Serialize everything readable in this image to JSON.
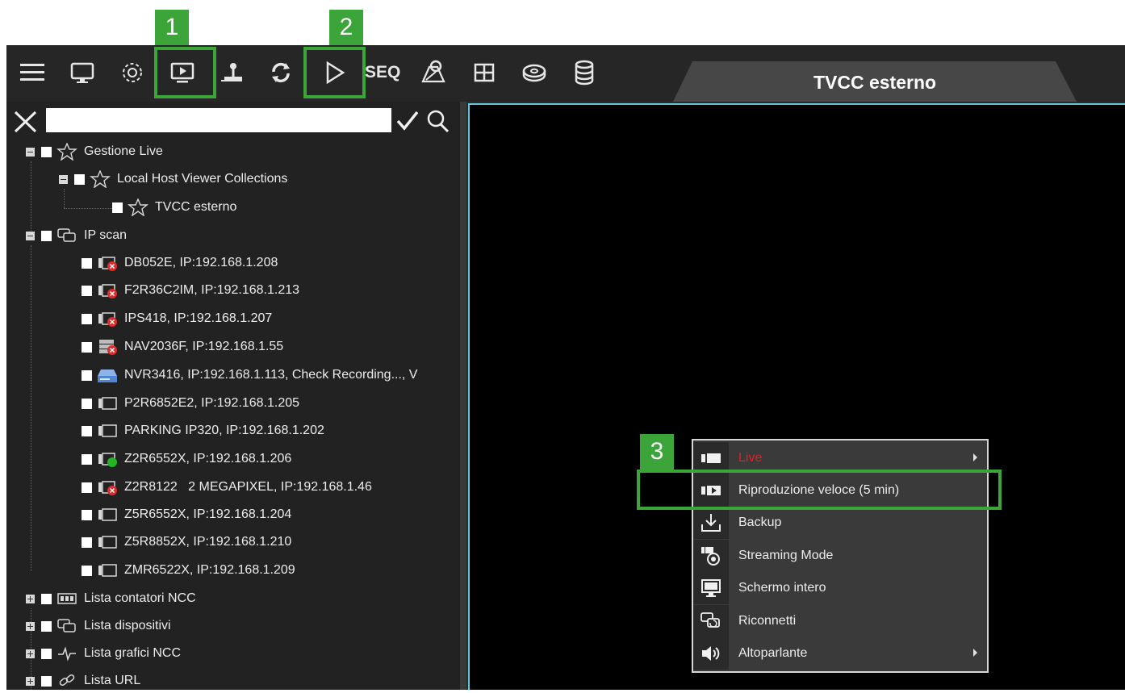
{
  "tab": {
    "label": "TVCC esterno"
  },
  "toolbar": {
    "seq_label": "SEQ",
    "buttons": [
      "menu-icon",
      "monitor-icon",
      "gear-icon",
      "playback-icon",
      "joystick-icon",
      "refresh-icon",
      "play-icon",
      "map-pin-icon",
      "layout-icon",
      "disk-icon",
      "database-icon"
    ]
  },
  "search": {
    "value": "",
    "placeholder": ""
  },
  "tree": [
    {
      "label": "Gestione Live",
      "icon": "star-icon"
    },
    {
      "label": "Local Host Viewer Collections",
      "icon": "star-icon"
    },
    {
      "label": "TVCC esterno",
      "icon": "star-icon"
    },
    {
      "label": "IP scan",
      "icon": "network-icon"
    },
    {
      "label": "DB052E, IP:192.168.1.208",
      "icon": "camera-offline-icon"
    },
    {
      "label": "F2R36C2IM, IP:192.168.1.213",
      "icon": "camera-offline-icon"
    },
    {
      "label": "IPS418, IP:192.168.1.207",
      "icon": "camera-offline-icon"
    },
    {
      "label": "NAV2036F, IP:192.168.1.55",
      "icon": "nvr-offline-icon"
    },
    {
      "label": "NVR3416, IP:192.168.1.113, Check Recording..., V",
      "icon": "nvr-icon"
    },
    {
      "label": "P2R6852E2, IP:192.168.1.205",
      "icon": "camera-icon"
    },
    {
      "label": "PARKING IP320, IP:192.168.1.202",
      "icon": "camera-icon"
    },
    {
      "label": "Z2R6552X, IP:192.168.1.206",
      "icon": "camera-online-icon"
    },
    {
      "label": "Z2R8122   2 MEGAPIXEL, IP:192.168.1.46",
      "icon": "camera-offline-icon"
    },
    {
      "label": "Z5R6552X, IP:192.168.1.204",
      "icon": "camera-icon"
    },
    {
      "label": "Z5R8852X, IP:192.168.1.210",
      "icon": "camera-icon"
    },
    {
      "label": "ZMR6522X, IP:192.168.1.209",
      "icon": "camera-icon"
    },
    {
      "label": "Lista contatori NCC",
      "icon": "counter-icon"
    },
    {
      "label": "Lista dispositivi",
      "icon": "network-icon"
    },
    {
      "label": "Lista grafici NCC",
      "icon": "chart-icon"
    },
    {
      "label": "Lista URL",
      "icon": "link-icon"
    }
  ],
  "context_menu": [
    {
      "label": "Live",
      "icon": "live-camera-icon",
      "submenu": true,
      "color": "#e02020"
    },
    {
      "label": "Riproduzione veloce (5 min)",
      "icon": "playback-icon",
      "submenu": false
    },
    {
      "label": "Backup",
      "icon": "download-icon",
      "submenu": false
    },
    {
      "label": "Streaming Mode",
      "icon": "streaming-icon",
      "submenu": false
    },
    {
      "label": "Schermo intero",
      "icon": "monitor-icon",
      "submenu": false
    },
    {
      "label": "Riconnetti",
      "icon": "reconnect-icon",
      "submenu": false
    },
    {
      "label": "Altoparlante",
      "icon": "speaker-icon",
      "submenu": true
    }
  ],
  "annotations": {
    "one": "1",
    "two": "2",
    "three": "3"
  },
  "colors": {
    "highlight": "#3ba53a",
    "video_border": "#67c6d6"
  }
}
